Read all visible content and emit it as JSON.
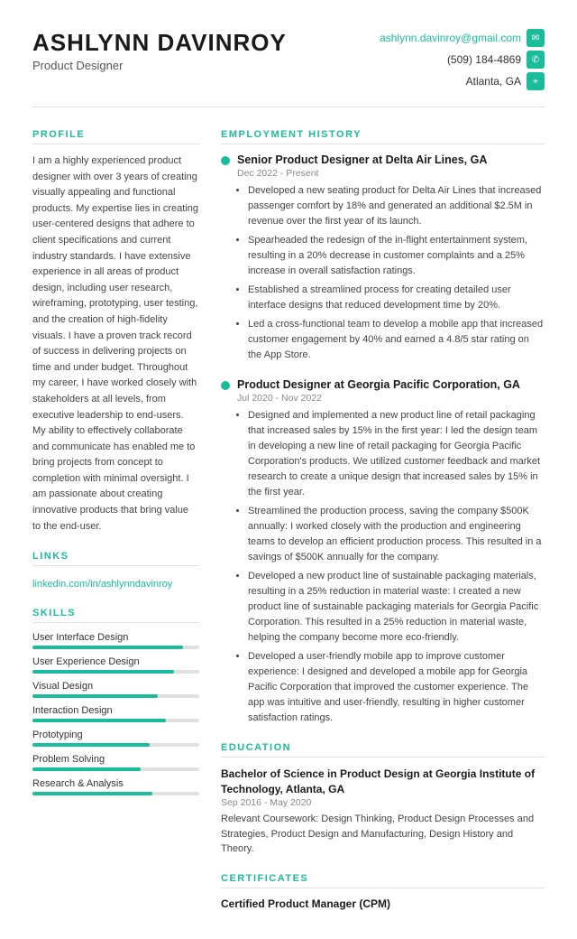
{
  "header": {
    "name": "ASHLYNN DAVINROY",
    "title": "Product Designer",
    "email": "ashlynn.davinroy@gmail.com",
    "phone": "(509) 184-4869",
    "location": "Atlanta, GA"
  },
  "profile": {
    "section_label": "PROFILE",
    "text": "I am a highly experienced product designer with over 3 years of creating visually appealing and functional products. My expertise lies in creating user-centered designs that adhere to client specifications and current industry standards. I have extensive experience in all areas of product design, including user research, wireframing, prototyping, user testing, and the creation of high-fidelity visuals. I have a proven track record of success in delivering projects on time and under budget. Throughout my career, I have worked closely with stakeholders at all levels, from executive leadership to end-users. My ability to effectively collaborate and communicate has enabled me to bring projects from concept to completion with minimal oversight. I am passionate about creating innovative products that bring value to the end-user."
  },
  "links": {
    "section_label": "LINKS",
    "linkedin": "linkedin.com/in/ashlynndavinroy"
  },
  "skills": {
    "section_label": "SKILLS",
    "items": [
      {
        "name": "User Interface Design",
        "level": 90
      },
      {
        "name": "User Experience Design",
        "level": 85
      },
      {
        "name": "Visual Design",
        "level": 75
      },
      {
        "name": "Interaction Design",
        "level": 80
      },
      {
        "name": "Prototyping",
        "level": 70
      },
      {
        "name": "Problem Solving",
        "level": 65
      },
      {
        "name": "Research & Analysis",
        "level": 72
      }
    ]
  },
  "employment": {
    "section_label": "EMPLOYMENT HISTORY",
    "jobs": [
      {
        "title": "Senior Product Designer at Delta Air Lines, GA",
        "date": "Dec 2022 - Present",
        "bullets": [
          "Developed a new seating product for Delta Air Lines that increased passenger comfort by 18% and generated an additional $2.5M in revenue over the first year of its launch.",
          "Spearheaded the redesign of the in-flight entertainment system, resulting in a 20% decrease in customer complaints and a 25% increase in overall satisfaction ratings.",
          "Established a streamlined process for creating detailed user interface designs that reduced development time by 20%.",
          "Led a cross-functional team to develop a mobile app that increased customer engagement by 40% and earned a 4.8/5 star rating on the App Store."
        ]
      },
      {
        "title": "Product Designer at Georgia Pacific Corporation, GA",
        "date": "Jul 2020 - Nov 2022",
        "bullets": [
          "Designed and implemented a new product line of retail packaging that increased sales by 15% in the first year: I led the design team in developing a new line of retail packaging for Georgia Pacific Corporation's products. We utilized customer feedback and market research to create a unique design that increased sales by 15% in the first year.",
          "Streamlined the production process, saving the company $500K annually: I worked closely with the production and engineering teams to develop an efficient production process. This resulted in a savings of $500K annually for the company.",
          "Developed a new product line of sustainable packaging materials, resulting in a 25% reduction in material waste: I created a new product line of sustainable packaging materials for Georgia Pacific Corporation. This resulted in a 25% reduction in material waste, helping the company become more eco-friendly.",
          "Developed a user-friendly mobile app to improve customer experience: I designed and developed a mobile app for Georgia Pacific Corporation that improved the customer experience. The app was intuitive and user-friendly, resulting in higher customer satisfaction ratings."
        ]
      }
    ]
  },
  "education": {
    "section_label": "EDUCATION",
    "degree": "Bachelor of Science in Product Design at Georgia Institute of Technology, Atlanta, GA",
    "date": "Sep 2016 - May 2020",
    "coursework": "Relevant Coursework: Design Thinking, Product Design Processes and Strategies, Product Design and Manufacturing, Design History and Theory."
  },
  "certificates": {
    "section_label": "CERTIFICATES",
    "title": "Certified Product Manager (CPM)"
  }
}
